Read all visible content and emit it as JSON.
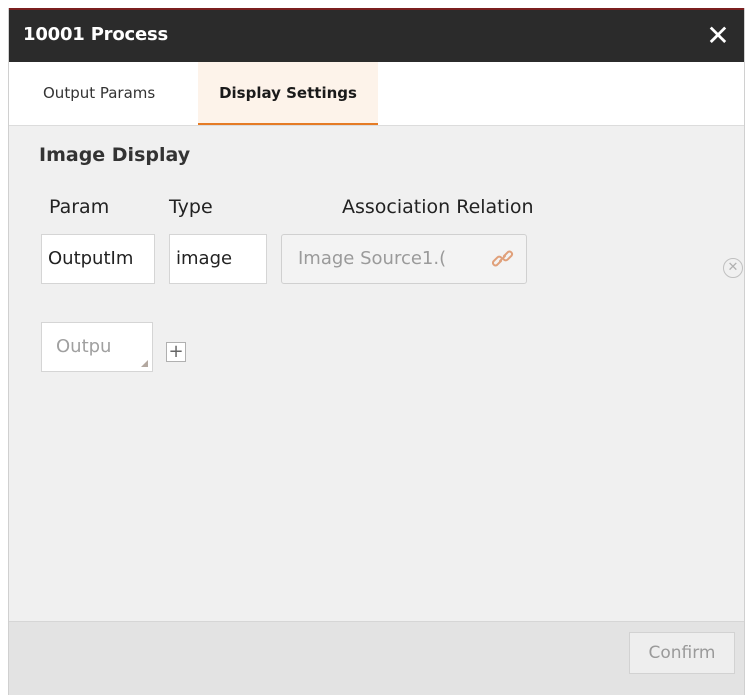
{
  "window": {
    "title": "10001 Process",
    "close_icon": "close-icon"
  },
  "tabs": [
    {
      "label": "Output Params",
      "active": false
    },
    {
      "label": "Display Settings",
      "active": true
    }
  ],
  "section": {
    "title": "Image Display"
  },
  "columns": {
    "param": "Param",
    "type": "Type",
    "association": "Association Relation"
  },
  "rows": [
    {
      "param": "OutputIm",
      "type": "image",
      "association": "Image Source1.(",
      "association_icon": "link-icon",
      "remove_icon": "remove-circle-icon"
    }
  ],
  "add_row": {
    "select_value": "Outpu",
    "add_icon": "plus-icon"
  },
  "footer": {
    "confirm_label": "Confirm"
  },
  "colors": {
    "accent": "#e57b25",
    "titlebar": "#2b2b2b"
  }
}
